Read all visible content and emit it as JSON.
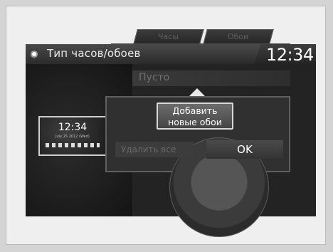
{
  "header": {
    "title": "Тип часов/обоев",
    "clock": "12:34"
  },
  "preview": {
    "time": "12:34",
    "date": "July 25 2012 (Wed)"
  },
  "tabs": [
    "Часы",
    "Обои"
  ],
  "list": {
    "empty_item": "Пусто"
  },
  "popup": {
    "add_label_line1": "Добавить",
    "add_label_line2": "новые обои",
    "delete_label": "Удалить все",
    "ok_label": "OK"
  },
  "icons": {
    "title": "bullet-icon",
    "popup_pointer": "triangle-up-icon"
  },
  "colors": {
    "screen_bg": "#151515",
    "text_primary": "#ffffff",
    "text_disabled": "#6f6f6f",
    "button_border": "#d8d8d8"
  }
}
